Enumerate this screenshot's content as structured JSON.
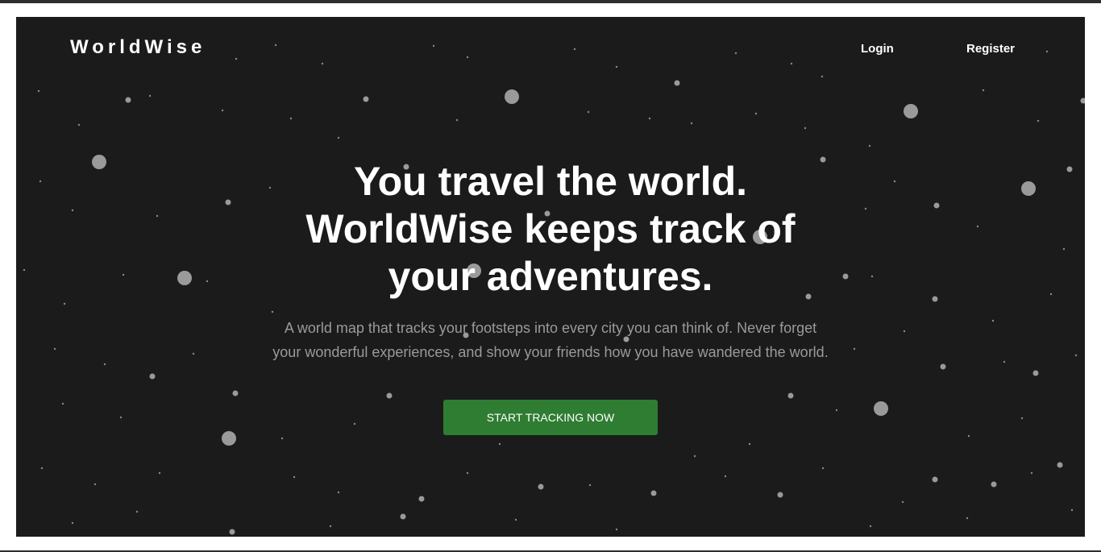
{
  "nav": {
    "logo": "WorldWise",
    "login_label": "Login",
    "register_label": "Register"
  },
  "hero": {
    "headline": "You travel the world. WorldWise keeps track of your adventures.",
    "subheadline": "A world map that tracks your footsteps into every city you can think of. Never forget your wonderful experiences, and show your friends how you have wandered the world.",
    "cta_label": "START TRACKING NOW"
  },
  "colors": {
    "background": "#1b1b1b",
    "star": "#9a9a9a",
    "cta": "#2e7d32",
    "text": "#ffffff",
    "muted_text": "#9a9a9a"
  }
}
